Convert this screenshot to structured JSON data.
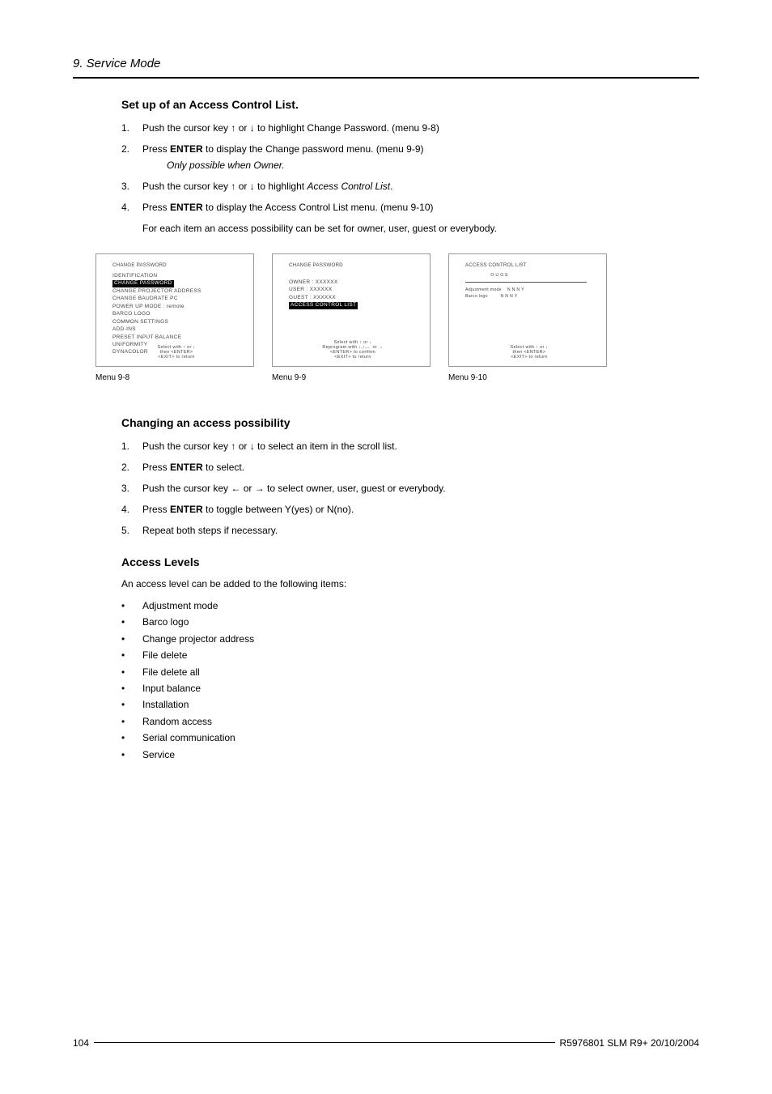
{
  "header": {
    "section": "9. Service Mode"
  },
  "section1": {
    "heading": "Set up of an Access Control List.",
    "steps": [
      {
        "num": "1.",
        "text_pre": "Push the cursor key ↑ or ↓ to highlight Change Password.  (menu 9-8)"
      },
      {
        "num": "2.",
        "text_pre": "Press ",
        "bold": "ENTER",
        "text_post": " to display the Change password menu.  (menu 9-9)",
        "note": "Only possible when Owner."
      },
      {
        "num": "3.",
        "text_pre": "Push the cursor key ↑ or ↓ to highlight ",
        "italic": "Access Control List",
        "text_post": "."
      },
      {
        "num": "4.",
        "text_pre": "Press ",
        "bold": "ENTER",
        "text_post": " to display the Access Control List menu.  (menu 9-10)"
      }
    ],
    "followup": "For each item an access possibility can be set for owner, user, guest or everybody."
  },
  "menus": {
    "m1": {
      "title": "CHANGE PASSWORD",
      "lines": [
        "IDENTIFICATION",
        "CHANGE PASSWORD",
        "CHANGE PROJECTOR ADDRESS",
        "CHANGE BAUDRATE PC",
        "POWER UP MODE : remote",
        "BARCO LOGO",
        "COMMON SETTINGS",
        "ADD-INS",
        "PRESET INPUT BALANCE",
        "UNIFORMITY",
        "DYNACOLOR"
      ],
      "highlight_index": 1,
      "hint": "Select with ↑ or ↓\nthen <ENTER>\n<EXIT> to return",
      "caption": "Menu 9-8"
    },
    "m2": {
      "title": "CHANGE PASSWORD",
      "lines": [
        "OWNER : XXXXXX",
        "USER : XXXXXX",
        "GUEST : XXXXXX",
        "",
        "ACCESS CONTROL LIST"
      ],
      "highlight_index": 4,
      "hint": "Select with ↑ or ↓\nReprogram with ↓,↑,← or →\n<ENTER> to confirm\n<EXIT> to return",
      "caption": "Menu 9-9"
    },
    "m3": {
      "title": "ACCESS CONTROL LIST",
      "header_row": "                  O U G E",
      "rows": [
        "Adjustment mode    N N N Y",
        "Barco logo         N N N Y"
      ],
      "hint": "Select with ↑ or ↓\nthen <ENTER>\n<EXIT> to return",
      "caption": "Menu 9-10"
    }
  },
  "section2": {
    "heading": "Changing an access possibility",
    "steps": [
      {
        "num": "1.",
        "text_pre": "Push the cursor key ↑ or ↓ to select an item in the scroll list."
      },
      {
        "num": "2.",
        "text_pre": "Press ",
        "bold": "ENTER",
        "text_post": " to select."
      },
      {
        "num": "3.",
        "text_pre": "Push the cursor key ← or → to select owner, user, guest or everybody."
      },
      {
        "num": "4.",
        "text_pre": "Press ",
        "bold": "ENTER",
        "text_post": " to toggle between Y(yes) or N(no)."
      },
      {
        "num": "5.",
        "text_pre": "Repeat both steps if necessary."
      }
    ]
  },
  "section3": {
    "heading": "Access Levels",
    "intro": "An access level can be added to the following items:",
    "items": [
      "Adjustment mode",
      "Barco logo",
      "Change projector address",
      "File delete",
      "File delete all",
      "Input balance",
      "Installation",
      "Random access",
      "Serial communication",
      "Service"
    ]
  },
  "footer": {
    "page": "104",
    "docid": "R5976801  SLM R9+  20/10/2004"
  }
}
